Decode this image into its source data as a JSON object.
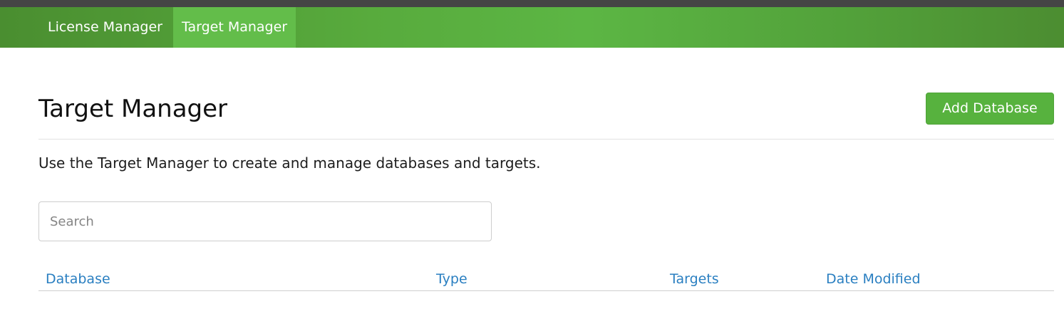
{
  "nav": {
    "items": [
      {
        "label": "License Manager",
        "active": false
      },
      {
        "label": "Target Manager",
        "active": true
      }
    ]
  },
  "header": {
    "title": "Target Manager",
    "add_button_label": "Add Database"
  },
  "description": "Use the Target Manager to create and manage databases and targets.",
  "search": {
    "placeholder": "Search",
    "value": ""
  },
  "table": {
    "columns": [
      "Database",
      "Type",
      "Targets",
      "Date Modified"
    ],
    "rows": []
  },
  "colors": {
    "nav_bg": "#58ab3d",
    "nav_active": "#63bd4a",
    "button_bg": "#57b23e",
    "link": "#2a7fc1",
    "top_strip": "#454545"
  }
}
